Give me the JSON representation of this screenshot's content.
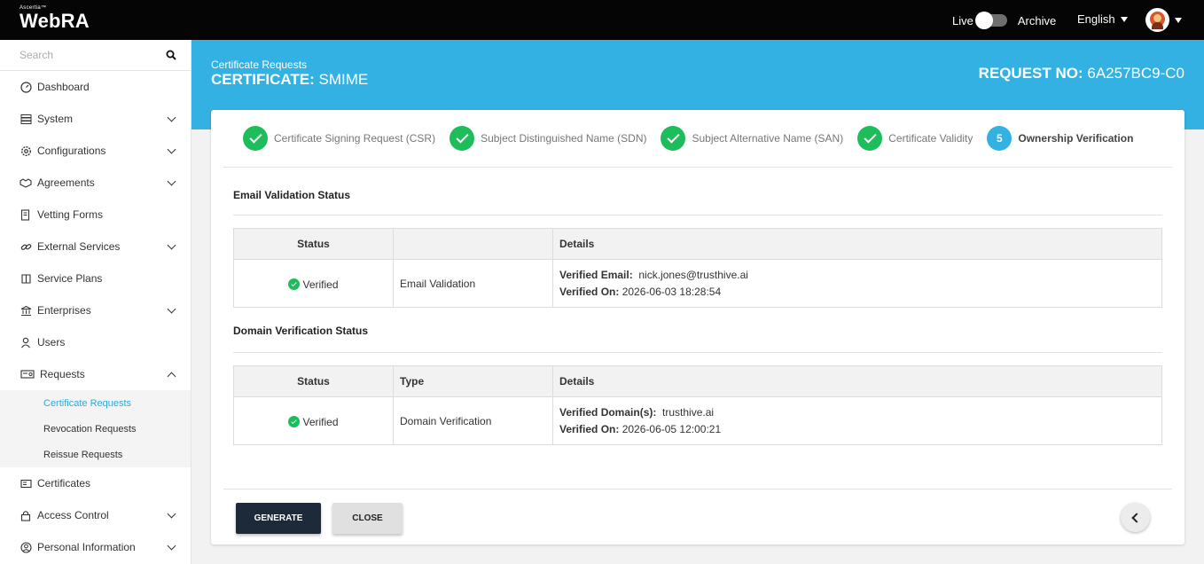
{
  "topbar": {
    "brand_small": "Ascertia™",
    "brand_main": "WebRA",
    "live_label": "Live",
    "archive_label": "Archive",
    "language": "English"
  },
  "sidebar": {
    "search_placeholder": "Search",
    "items": [
      {
        "label": "Dashboard",
        "icon": "dashboard-icon"
      },
      {
        "label": "System",
        "icon": "system-icon"
      },
      {
        "label": "Configurations",
        "icon": "gear-icon"
      },
      {
        "label": "Agreements",
        "icon": "handshake-icon"
      },
      {
        "label": "Vetting Forms",
        "icon": "form-icon"
      },
      {
        "label": "External Services",
        "icon": "link-icon"
      },
      {
        "label": "Service Plans",
        "icon": "plans-icon"
      },
      {
        "label": "Enterprises",
        "icon": "building-icon"
      },
      {
        "label": "Users",
        "icon": "user-icon"
      },
      {
        "label": "Requests",
        "icon": "requests-icon"
      },
      {
        "label": "Certificates",
        "icon": "certificate-icon"
      },
      {
        "label": "Access Control",
        "icon": "lock-icon"
      },
      {
        "label": "Personal Information",
        "icon": "person-circle-icon"
      }
    ],
    "requests_sub": [
      "Certificate Requests",
      "Revocation Requests",
      "Reissue Requests"
    ]
  },
  "header": {
    "breadcrumb": "Certificate Requests",
    "cert_prefix": "CERTIFICATE:",
    "cert_type": "SMIME",
    "req_prefix": "REQUEST NO:",
    "req_number": "6A257BC9-C0"
  },
  "steps": [
    {
      "label": "Certificate Signing Request (CSR)",
      "state": "done"
    },
    {
      "label": "Subject Distinguished Name (SDN)",
      "state": "done"
    },
    {
      "label": "Subject Alternative Name (SAN)",
      "state": "done"
    },
    {
      "label": "Certificate Validity",
      "state": "done"
    },
    {
      "label": "Ownership Verification",
      "state": "active",
      "number": "5"
    }
  ],
  "email_section": {
    "title": "Email Validation Status",
    "headers": [
      "Status",
      "",
      "Details"
    ],
    "row": {
      "status": "Verified",
      "type": "Email Validation",
      "detail1_label": "Verified Email:",
      "detail1_value": "nick.jones@trusthive.ai",
      "detail2_label": "Verified On:",
      "detail2_value": "2026-06-03 18:28:54"
    }
  },
  "domain_section": {
    "title": "Domain Verification Status",
    "headers": [
      "Status",
      "Type",
      "Details"
    ],
    "row": {
      "status": "Verified",
      "type": "Domain Verification",
      "detail1_label": "Verified Domain(s):",
      "detail1_value": "trusthive.ai",
      "detail2_label": "Verified On:",
      "detail2_value": "2026-06-05 12:00:21"
    }
  },
  "buttons": {
    "generate": "GENERATE",
    "close": "CLOSE"
  },
  "colors": {
    "accent": "#33b1e3",
    "success": "#1cbd5a",
    "dark_button": "#1d2a3a"
  }
}
